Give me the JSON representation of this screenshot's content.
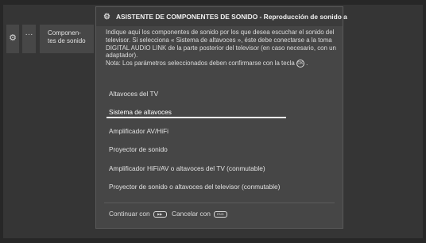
{
  "sidebar": {
    "gear_icon": "gear-icon",
    "dots_label": "···",
    "menu_label_line1": "Componen-",
    "menu_label_line2": "tes de sonido"
  },
  "dialog": {
    "title": "ASISTENTE DE COMPONENTES DE SONIDO - Reproducción de sonido a",
    "description": "Indique aquí los componentes de sonido por los que desea escuchar el sonido del televisor. Si selecciona « Sistema de altavoces », éste debe conectarse a la toma DIGITAL AUDIO LINK de la parte posterior del televisor (en caso necesario, con un adaptador).",
    "note": "Nota: Los parámetros seleccionados deben confirmarse con la tecla",
    "note_end": ".",
    "ok_key_label": "OK",
    "options": [
      "Altavoces del TV",
      "Sistema de altavoces",
      "Amplificador AV/HiFi",
      "Proyector de sonido",
      "Amplificador HiFi/AV o altavoces del TV (conmutable)",
      "Proyector de sonido o altavoces del televisor (conmutable)"
    ],
    "selected_index": 1,
    "footer": {
      "continue_label": "Continuar con",
      "continue_key": "▶▶",
      "cancel_label": "Cancelar con",
      "cancel_key": "END"
    }
  },
  "colors": {
    "background": "#272727",
    "dialog": "#464646",
    "selection": "#f2f2f2"
  }
}
